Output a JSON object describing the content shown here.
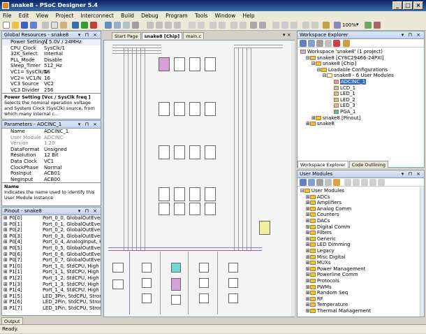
{
  "window": {
    "title": "snake8 - PSoC Designer 5.4"
  },
  "menu": [
    "File",
    "Edit",
    "View",
    "Project",
    "Interconnect",
    "Build",
    "Debug",
    "Program",
    "Tools",
    "Window",
    "Help"
  ],
  "toolbar": {
    "zoom": "100%"
  },
  "global_resources": {
    "title": "Global Resources - snake8",
    "rows": [
      {
        "k": "Power Setting [",
        "v": "V 5.0V / 24MHz"
      },
      {
        "k": "CPU_Clock",
        "v": "SysClk/1"
      },
      {
        "k": "32K_Select",
        "v": "Internal"
      },
      {
        "k": "PLL_Mode",
        "v": "Disable"
      },
      {
        "k": "Sleep_Timer",
        "v": "512_Hz"
      },
      {
        "k": "VC1= SysClk/N",
        "v": "16"
      },
      {
        "k": "VC2= VC1/N",
        "v": "16"
      },
      {
        "k": "VC3 Source",
        "v": "VC2"
      },
      {
        "k": "VC3 Divider",
        "v": "256"
      }
    ],
    "desc_title": "Power Setting [Vcc / SysClk freq ]",
    "desc_text": "Selects the nominal operation voltage and System Clock (SysClk) source, from which many internal c..."
  },
  "parameters": {
    "title": "Parameters - ADCINC_1",
    "rows": [
      {
        "k": "Name",
        "v": "ADCINC_1",
        "gray": false
      },
      {
        "k": "User Module",
        "v": "ADCINC",
        "gray": true
      },
      {
        "k": "Version",
        "v": "1.20",
        "gray": true
      },
      {
        "k": "DataFormat",
        "v": "Unsigned",
        "gray": false
      },
      {
        "k": "Resolution",
        "v": "12 Bit",
        "gray": false
      },
      {
        "k": "Data Clock",
        "v": "VC1",
        "gray": false
      },
      {
        "k": "ClockPhase",
        "v": "Normal",
        "gray": false
      },
      {
        "k": "PosInput",
        "v": "ACB01",
        "gray": false
      },
      {
        "k": "NegInput",
        "v": "ACB00",
        "gray": false
      }
    ],
    "desc_title": "Name",
    "desc_text": "Indicates the name used to identify this User Module instance"
  },
  "pinout": {
    "title": "Pinout - snake8",
    "rows": [
      {
        "k": "P0[0]",
        "v": "Port_0_0, GlobalOutEven_0"
      },
      {
        "k": "P0[1]",
        "v": "Port_0_1, GlobalOutEven_1"
      },
      {
        "k": "P0[2]",
        "v": "Port_0_2, GlobalOutEven_2"
      },
      {
        "k": "P0[3]",
        "v": "Port_0_3, GlobalOutEven_3"
      },
      {
        "k": "P0[4]",
        "v": "Port_0_4, AnalogInput, High"
      },
      {
        "k": "P0[5]",
        "v": "Port_0_5, GlobalOutEven_5"
      },
      {
        "k": "P0[6]",
        "v": "Port_0_6, GlobalOutEven_6"
      },
      {
        "k": "P0[7]",
        "v": "Port_0_7, GlobalOutEven_7"
      },
      {
        "k": "P1[0]",
        "v": "Port_1_0, StdCPU, High Z A"
      },
      {
        "k": "P1[1]",
        "v": "Port_1_1, StdCPU, High Z A"
      },
      {
        "k": "P1[2]",
        "v": "Port_1_2, StdCPU, High Z A"
      },
      {
        "k": "P1[3]",
        "v": "Port_1_3, StdCPU, High Z A"
      },
      {
        "k": "P1[4]",
        "v": "Port_1_4, StdCPU, High Z A"
      },
      {
        "k": "P1[5]",
        "v": "LED_3Pin, StdCPU, Strong,"
      },
      {
        "k": "P1[6]",
        "v": "LED_2Pin, StdCPU, Strong,"
      },
      {
        "k": "P1[7]",
        "v": "LED_1Pin, StdCPU, Strong,"
      }
    ]
  },
  "editor_tabs": [
    "Start Page",
    "snake8 [Chip]",
    "main.c"
  ],
  "workspace": {
    "title": "Workspace Explorer",
    "items": [
      {
        "t": "Workspace 'snake8' (1 project)",
        "lvl": 0
      },
      {
        "t": "snake8 [CY8C29466-24PXI]",
        "lvl": 1
      },
      {
        "t": "snake8 [Chip]",
        "lvl": 2
      },
      {
        "t": "Loadable Configurations",
        "lvl": 3
      },
      {
        "t": "snake8 - 6 User Modules",
        "lvl": 4
      },
      {
        "t": "ADCINC_1",
        "lvl": 5,
        "sel": true
      },
      {
        "t": "LCD_1",
        "lvl": 5
      },
      {
        "t": "LED_1",
        "lvl": 5
      },
      {
        "t": "LED_2",
        "lvl": 5
      },
      {
        "t": "LED_3",
        "lvl": 5
      },
      {
        "t": "PGA_1",
        "lvl": 5
      },
      {
        "t": "snake8 [Pinout]",
        "lvl": 2
      },
      {
        "t": "snake8",
        "lvl": 1
      }
    ],
    "tabs": [
      "Workspace Explorer",
      "Code Outlining"
    ]
  },
  "user_modules": {
    "title": "User Modules",
    "items": [
      "User Modules",
      "ADCs",
      "Amplifiers",
      "Analog Comm",
      "Counters",
      "DACs",
      "Digital Comm",
      "Filters",
      "Generic",
      "LED Dimming",
      "Legacy",
      "Misc Digital",
      "MUXs",
      "Power Management",
      "Powerline Comm",
      "Protocols",
      "PWMs",
      "Random Seq",
      "RF",
      "Temperature",
      "Thermal Management"
    ]
  },
  "output_tab": "Output",
  "status": "Ready."
}
